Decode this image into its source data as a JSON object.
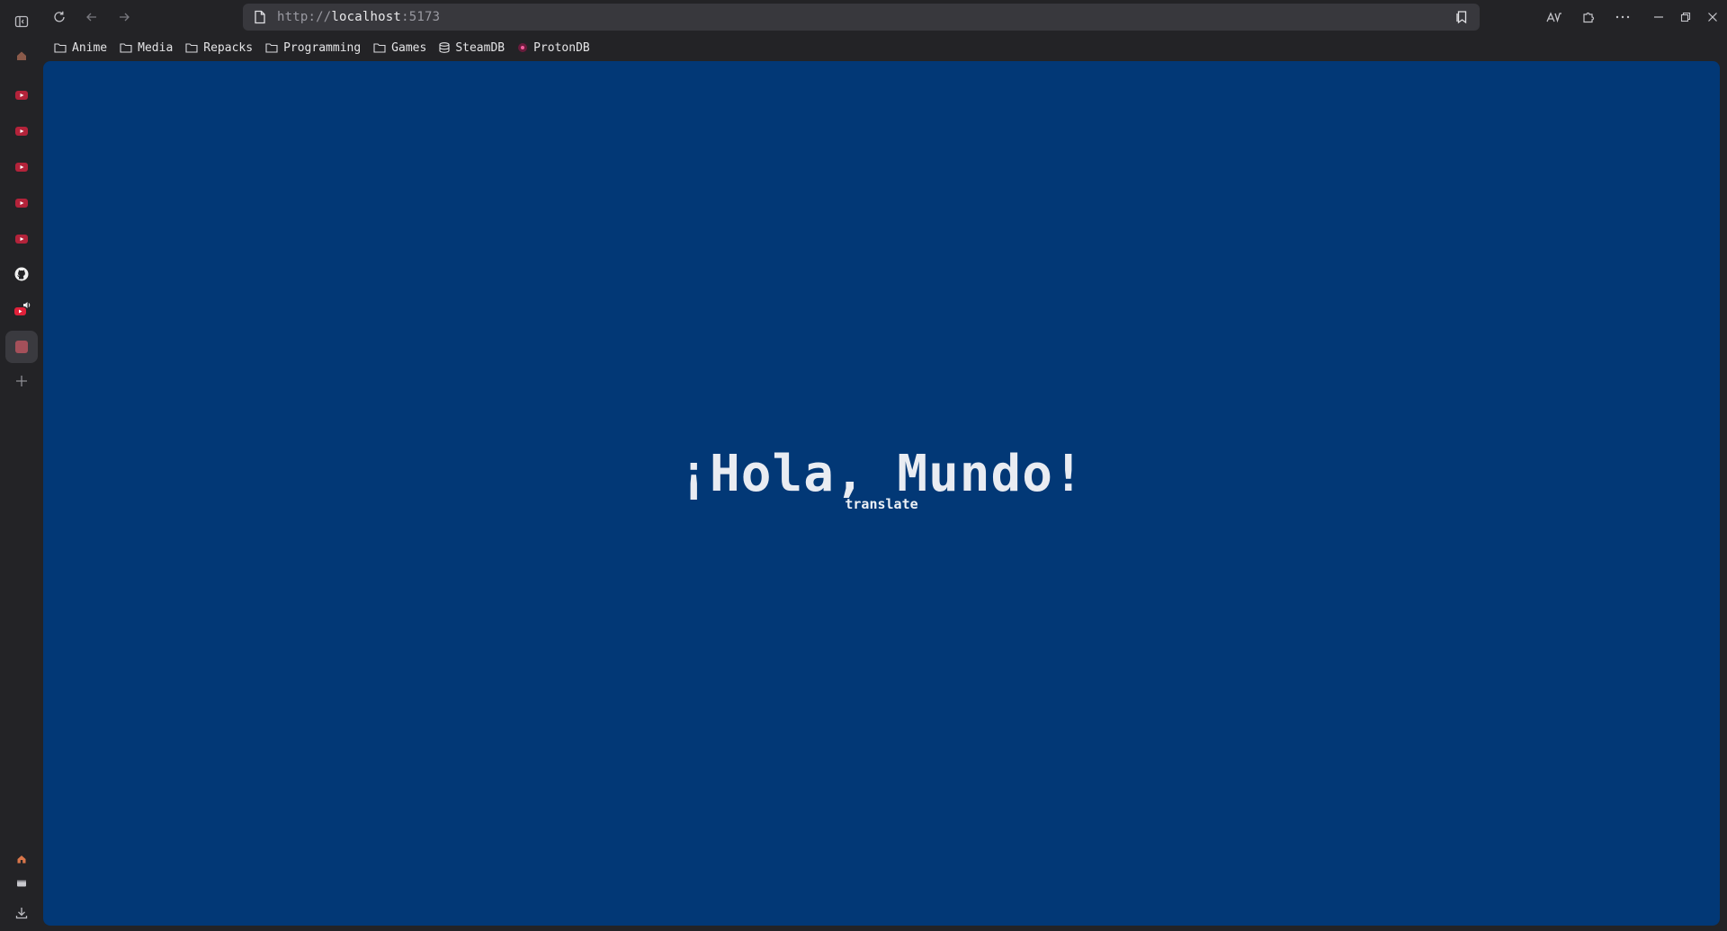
{
  "browser": {
    "url_scheme": "http://",
    "url_host": "localhost",
    "url_port": ":5173",
    "bookmarks": [
      {
        "label": "Anime",
        "icon": "folder-icon"
      },
      {
        "label": "Media",
        "icon": "folder-icon"
      },
      {
        "label": "Repacks",
        "icon": "folder-icon"
      },
      {
        "label": "Programming",
        "icon": "folder-icon"
      },
      {
        "label": "Games",
        "icon": "folder-icon"
      },
      {
        "label": "SteamDB",
        "icon": "steamdb-icon"
      },
      {
        "label": "ProtonDB",
        "icon": "protondb-icon"
      }
    ]
  },
  "page": {
    "title": "¡Hola, Mundo!",
    "link": "translate",
    "background": "#023876"
  },
  "colors": {
    "chrome": "#232326",
    "urlbar": "#38383d",
    "youtube": "#e0213a"
  }
}
